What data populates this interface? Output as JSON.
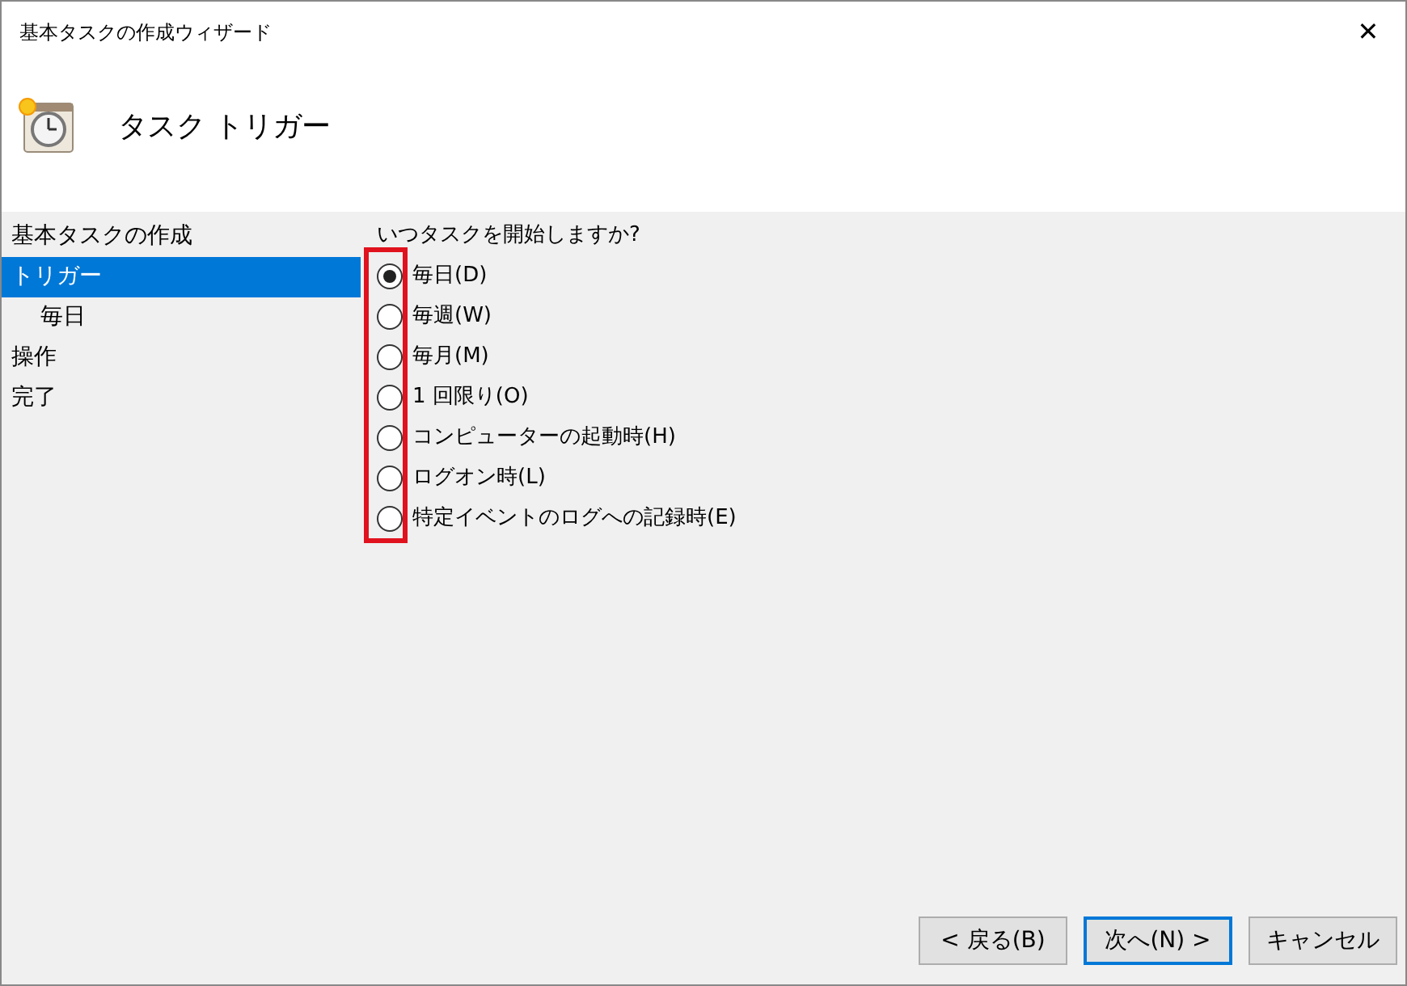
{
  "window": {
    "title": "基本タスクの作成ウィザード",
    "close": "✕"
  },
  "header": {
    "title": "タスク トリガー"
  },
  "sidebar": {
    "items": [
      {
        "label": "基本タスクの作成",
        "selected": false
      },
      {
        "label": "トリガー",
        "selected": true,
        "children": [
          {
            "label": "毎日",
            "selected": false
          }
        ]
      },
      {
        "label": "操作",
        "selected": false
      },
      {
        "label": "完了",
        "selected": false
      }
    ]
  },
  "question": "いつタスクを開始しますか?",
  "options": [
    {
      "label": "毎日(D)",
      "selected": true
    },
    {
      "label": "毎週(W)",
      "selected": false
    },
    {
      "label": "毎月(M)",
      "selected": false
    },
    {
      "label": "1 回限り(O)",
      "selected": false
    },
    {
      "label": "コンピューターの起動時(H)",
      "selected": false
    },
    {
      "label": "ログオン時(L)",
      "selected": false
    },
    {
      "label": "特定イベントのログへの記録時(E)",
      "selected": false
    }
  ],
  "buttons": [
    {
      "label": "< 戻る(B)",
      "focused": false
    },
    {
      "label": "次へ(N) >",
      "focused": true
    },
    {
      "label": "キャンセル",
      "focused": false
    }
  ]
}
